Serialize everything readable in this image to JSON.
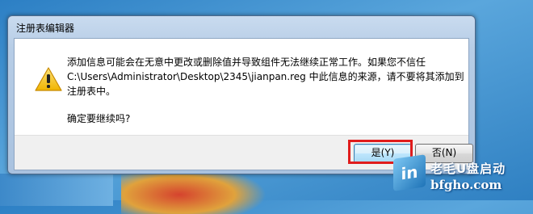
{
  "window": {
    "title": "注册表编辑器"
  },
  "message": {
    "lines": [
      "添加信息可能会在无意中更改或删除值并导致组件无法继续正常工作。如果您不信任",
      "C:\\Users\\Administrator\\Desktop\\2345\\jianpan.reg 中此信息的来源，请不要将其添加到",
      "注册表中。"
    ],
    "question": "确定要继续吗?"
  },
  "buttons": {
    "yes_label": "是(Y)",
    "no_label": "否(N)"
  },
  "icons": {
    "warning": "warning-icon"
  },
  "watermark": {
    "logo_text": "in",
    "brand_cn": "老毛U盘启动",
    "brand_url": "bfgho.com"
  },
  "colors": {
    "highlight": "#e01c1c",
    "warning_fill": "#f5c518"
  }
}
